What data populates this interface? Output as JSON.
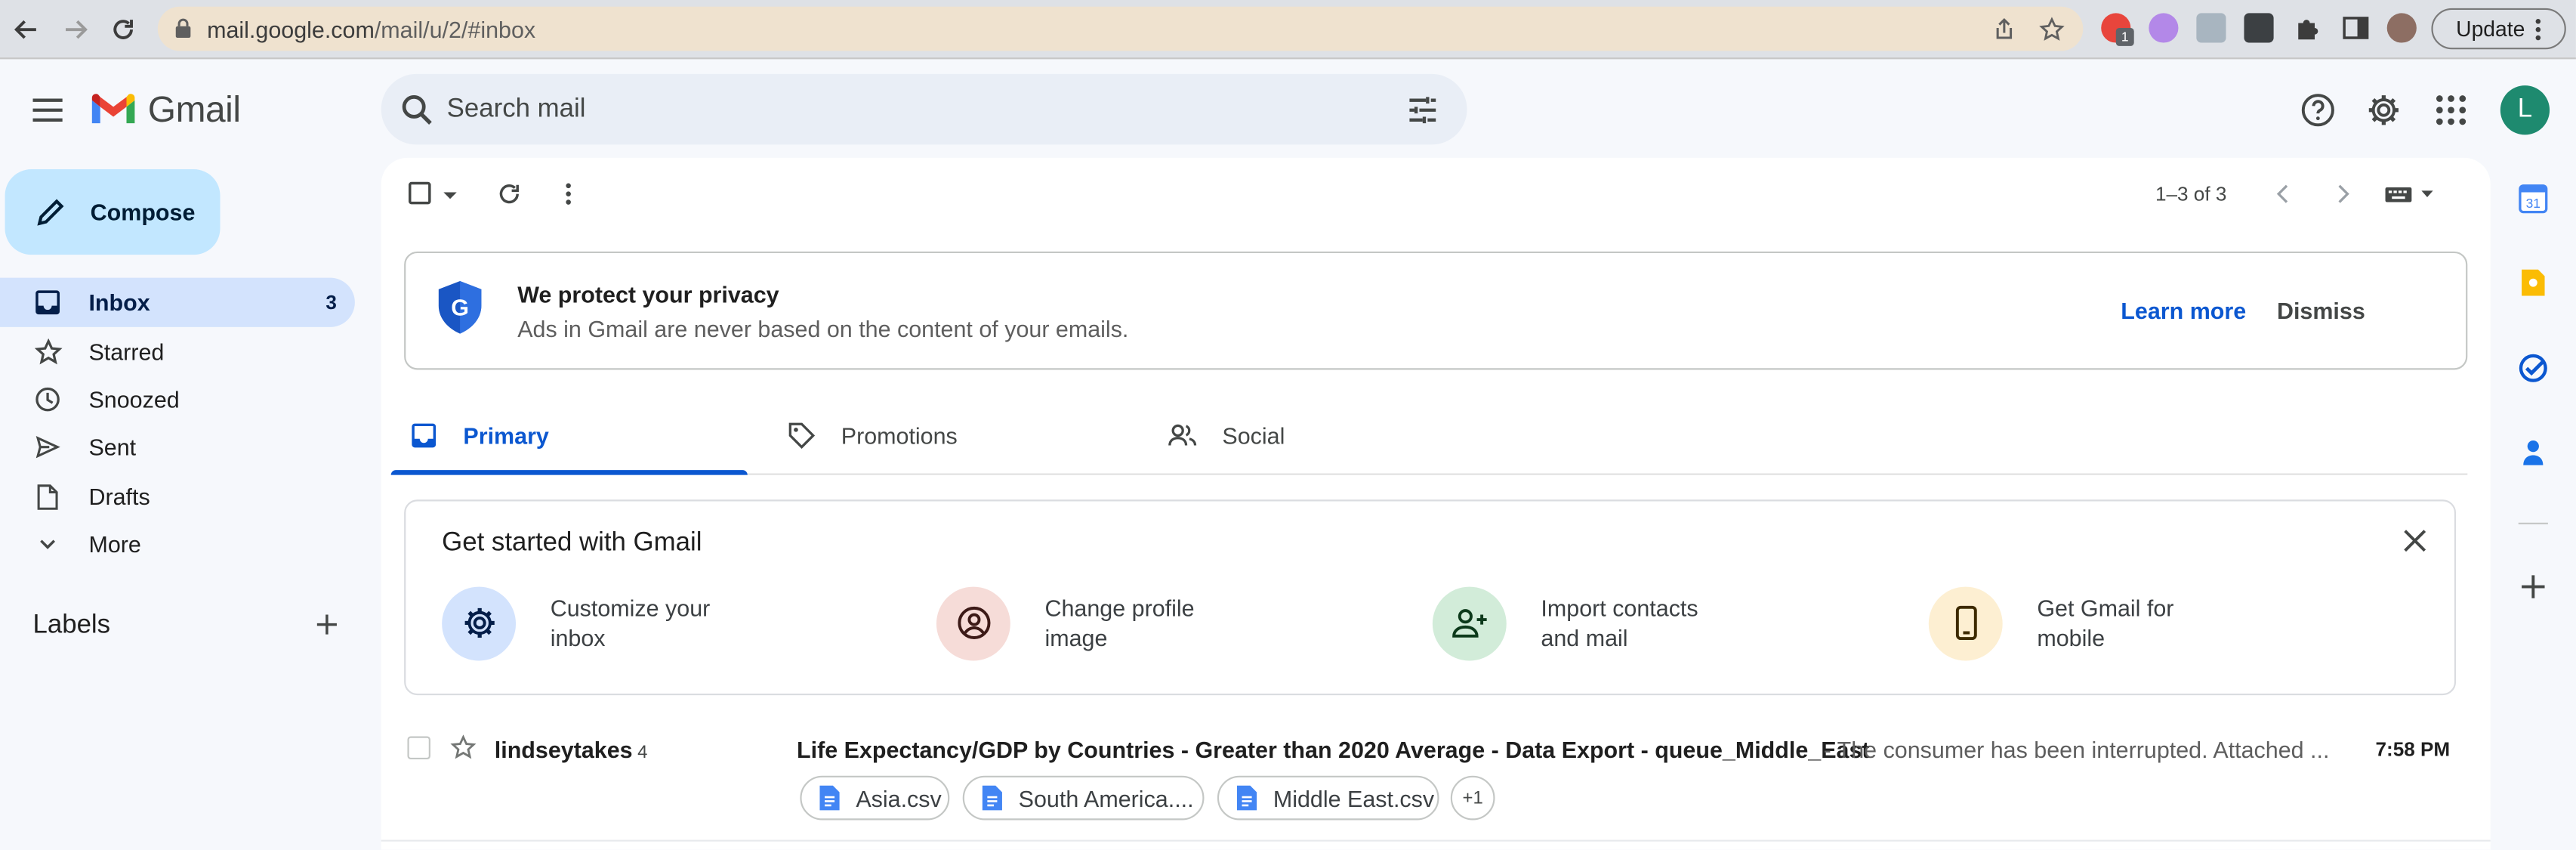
{
  "browser": {
    "url_host": "mail.google.com",
    "url_path": "/mail/u/2/#inbox",
    "update_label": "Update",
    "extension_badge": "1"
  },
  "header": {
    "logo_text": "Gmail",
    "search_placeholder": "Search mail",
    "avatar_letter": "L"
  },
  "sidebar": {
    "compose_label": "Compose",
    "items": [
      {
        "label": "Inbox",
        "count": "3",
        "icon": "inbox-icon"
      },
      {
        "label": "Starred",
        "count": "",
        "icon": "star-icon"
      },
      {
        "label": "Snoozed",
        "count": "",
        "icon": "clock-icon"
      },
      {
        "label": "Sent",
        "count": "",
        "icon": "send-icon"
      },
      {
        "label": "Drafts",
        "count": "",
        "icon": "draft-icon"
      },
      {
        "label": "More",
        "count": "",
        "icon": "chevron-down-icon"
      }
    ],
    "labels_heading": "Labels"
  },
  "toolbar": {
    "pagination": "1–3 of 3"
  },
  "privacy_banner": {
    "title": "We protect your privacy",
    "subtitle": "Ads in Gmail are never based on the content of your emails.",
    "learn_more": "Learn more",
    "dismiss": "Dismiss"
  },
  "tabs": [
    {
      "label": "Primary",
      "active": true
    },
    {
      "label": "Promotions",
      "active": false
    },
    {
      "label": "Social",
      "active": false
    }
  ],
  "get_started": {
    "title": "Get started with Gmail",
    "items": [
      {
        "line1": "Customize your",
        "line2": "inbox",
        "icon": "gear-icon",
        "color": "#d3e3fd"
      },
      {
        "line1": "Change profile",
        "line2": "image",
        "icon": "account-circle-icon",
        "color": "#f6dcd8"
      },
      {
        "line1": "Import contacts",
        "line2": "and mail",
        "icon": "person-add-icon",
        "color": "#d2ecd9"
      },
      {
        "line1": "Get Gmail for",
        "line2": "mobile",
        "icon": "phone-icon",
        "color": "#fdefd2"
      }
    ]
  },
  "emails": [
    {
      "sender": "lindseytakes",
      "thread_count": "4",
      "subject": "Life Expectancy/GDP by Countries - Greater than 2020 Average - Data Export - queue_Middle_East",
      "snippet": " - The consumer has been interrupted. Attached ...",
      "time": "7:58 PM",
      "attachments": [
        "Asia.csv",
        "South America....",
        "Middle East.csv"
      ],
      "more_attachments": "+1"
    }
  ],
  "colors": {
    "accent": "#0b57d0",
    "compose_bg": "#c2e7ff",
    "active_nav": "#d3e3fd",
    "page_bg": "#f6f8fc"
  }
}
